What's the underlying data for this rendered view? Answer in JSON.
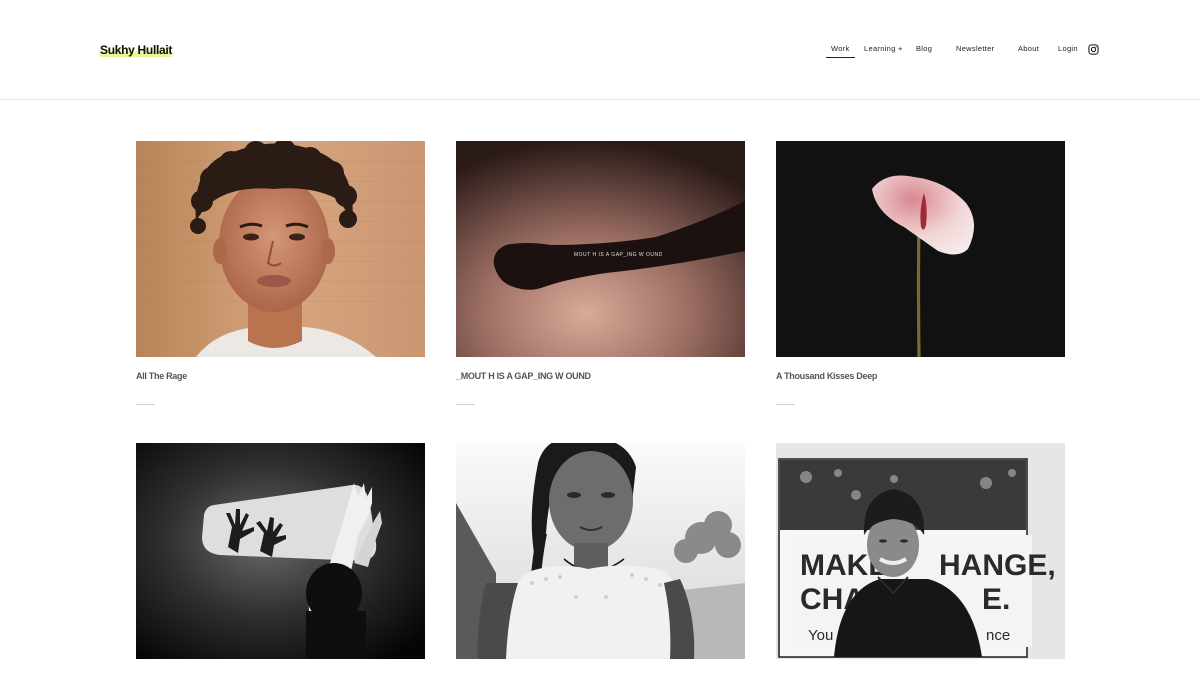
{
  "site": {
    "brand": "Sukhy Hullait"
  },
  "nav": {
    "items": [
      {
        "label": "Work",
        "active": true
      },
      {
        "label": "Learning +",
        "active": false
      },
      {
        "label": "Blog",
        "active": false
      },
      {
        "label": "Newsletter",
        "active": false
      },
      {
        "label": "About",
        "active": false
      },
      {
        "label": "Login",
        "active": false
      }
    ],
    "social_icon": "instagram-icon"
  },
  "projects": [
    {
      "title": "All The Rage",
      "image": "portrait of young man with curly hair against brick wall"
    },
    {
      "title": "_MOUT H IS A GAP_ING W OUND",
      "image": "silhouetted arm with projected text"
    },
    {
      "title": "A Thousand Kisses Deep",
      "image": "pink anthurium flower on black"
    },
    {
      "title": "",
      "image": "hand shadows in window light, black and white"
    },
    {
      "title": "",
      "image": "girl in white dress, black and white"
    },
    {
      "title": "",
      "image": "man in beanie before MAKE CHANGE sign, black and white"
    }
  ],
  "sign_text": {
    "line1": "MAKE",
    "line1b": "HANGE,",
    "line2": "CHA",
    "line2b": "E.",
    "line3": "You",
    "line3b": "nce"
  },
  "arm_text": "MOUT H IS A GAP_ING W OUND",
  "colors": {
    "brand_highlight": "#eaf59a",
    "divider": "#e4e4e4",
    "title_text": "#555555"
  }
}
